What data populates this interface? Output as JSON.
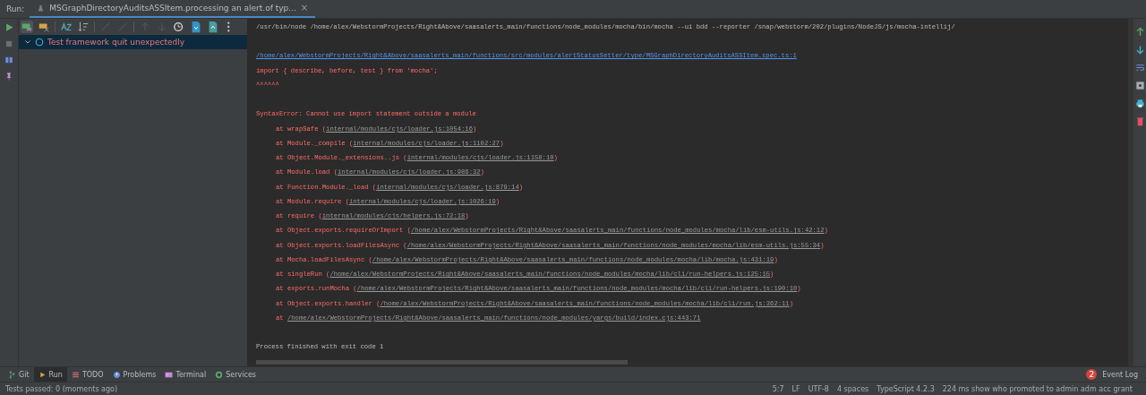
{
  "run_tabs": {
    "label": "Run:",
    "tabs": [
      {
        "title": "MSGraphDirectoryAuditsASSItem.processing an alert.of typ...",
        "close": "×",
        "selected": true
      }
    ]
  },
  "test_tree": {
    "items": [
      {
        "label": "Test framework quit unexpectedly",
        "expanded": true,
        "selected": true
      }
    ]
  },
  "console": {
    "lines": [
      {
        "kind": "plain",
        "parts": [
          {
            "kind": "text",
            "text": "/usr/bin/node /home/alex/WebstormProjects/Right&Above/saasalerts_main/functions/node_modules/mocha/bin/mocha --ui bdd --reporter /snap/webstorm/202/plugins/NodeJS/js/mocha-intellij/"
          }
        ]
      },
      {
        "kind": "blank"
      },
      {
        "kind": "error",
        "parts": [
          {
            "kind": "file_link",
            "text": "/home/alex/WebstormProjects/Right&Above/saasalerts_main/functions/src/modules/alertStatusSetter/type/MSGraphDirectoryAuditsASSItem.spec.ts:1"
          }
        ]
      },
      {
        "kind": "error",
        "parts": [
          {
            "kind": "text",
            "text": "import { describe, before, test } from 'mocha';"
          }
        ]
      },
      {
        "kind": "error",
        "parts": [
          {
            "kind": "text",
            "text": "^^^^^^"
          }
        ]
      },
      {
        "kind": "blank"
      },
      {
        "kind": "error",
        "parts": [
          {
            "kind": "text",
            "text": "SyntaxError: Cannot use import statement outside a module"
          }
        ]
      },
      {
        "kind": "stack",
        "parts": [
          {
            "kind": "text",
            "text": "at wrapSafe ("
          },
          {
            "kind": "link",
            "text": "internal/modules/cjs/loader.js:1054:16"
          },
          {
            "kind": "text",
            "text": ")"
          }
        ]
      },
      {
        "kind": "stack",
        "parts": [
          {
            "kind": "text",
            "text": "at Module._compile ("
          },
          {
            "kind": "link",
            "text": "internal/modules/cjs/loader.js:1102:27"
          },
          {
            "kind": "text",
            "text": ")"
          }
        ]
      },
      {
        "kind": "stack",
        "parts": [
          {
            "kind": "text",
            "text": "at Object.Module._extensions..js ("
          },
          {
            "kind": "link",
            "text": "internal/modules/cjs/loader.js:1158:10"
          },
          {
            "kind": "text",
            "text": ")"
          }
        ]
      },
      {
        "kind": "stack",
        "parts": [
          {
            "kind": "text",
            "text": "at Module.load ("
          },
          {
            "kind": "link",
            "text": "internal/modules/cjs/loader.js:986:32"
          },
          {
            "kind": "text",
            "text": ")"
          }
        ]
      },
      {
        "kind": "stack",
        "parts": [
          {
            "kind": "text",
            "text": "at Function.Module._load ("
          },
          {
            "kind": "link",
            "text": "internal/modules/cjs/loader.js:879:14"
          },
          {
            "kind": "text",
            "text": ")"
          }
        ]
      },
      {
        "kind": "stack",
        "parts": [
          {
            "kind": "text",
            "text": "at Module.require ("
          },
          {
            "kind": "link",
            "text": "internal/modules/cjs/loader.js:1026:19"
          },
          {
            "kind": "text",
            "text": ")"
          }
        ]
      },
      {
        "kind": "stack",
        "parts": [
          {
            "kind": "text",
            "text": "at require ("
          },
          {
            "kind": "link",
            "text": "internal/modules/cjs/helpers.js:72:18"
          },
          {
            "kind": "text",
            "text": ")"
          }
        ]
      },
      {
        "kind": "stack",
        "parts": [
          {
            "kind": "text",
            "text": "at Object.exports.requireOrImport ("
          },
          {
            "kind": "link",
            "text": "/home/alex/WebstormProjects/Right&Above/saasalerts_main/functions/node_modules/mocha/lib/esm-utils.js:42:12"
          },
          {
            "kind": "text",
            "text": ")"
          }
        ]
      },
      {
        "kind": "stack",
        "parts": [
          {
            "kind": "text",
            "text": "at Object.exports.loadFilesAsync ("
          },
          {
            "kind": "link",
            "text": "/home/alex/WebstormProjects/Right&Above/saasalerts_main/functions/node_modules/mocha/lib/esm-utils.js:55:34"
          },
          {
            "kind": "text",
            "text": ")"
          }
        ]
      },
      {
        "kind": "stack",
        "parts": [
          {
            "kind": "text",
            "text": "at Mocha.loadFilesAsync ("
          },
          {
            "kind": "link",
            "text": "/home/alex/WebstormProjects/Right&Above/saasalerts_main/functions/node_modules/mocha/lib/mocha.js:431:19"
          },
          {
            "kind": "text",
            "text": ")"
          }
        ]
      },
      {
        "kind": "stack",
        "parts": [
          {
            "kind": "text",
            "text": "at singleRun ("
          },
          {
            "kind": "link",
            "text": "/home/alex/WebstormProjects/Right&Above/saasalerts_main/functions/node_modules/mocha/lib/cli/run-helpers.js:125:15"
          },
          {
            "kind": "text",
            "text": ")"
          }
        ]
      },
      {
        "kind": "stack",
        "parts": [
          {
            "kind": "text",
            "text": "at exports.runMocha ("
          },
          {
            "kind": "link",
            "text": "/home/alex/WebstormProjects/Right&Above/saasalerts_main/functions/node_modules/mocha/lib/cli/run-helpers.js:190:10"
          },
          {
            "kind": "text",
            "text": ")"
          }
        ]
      },
      {
        "kind": "stack",
        "parts": [
          {
            "kind": "text",
            "text": "at Object.exports.handler ("
          },
          {
            "kind": "link",
            "text": "/home/alex/WebstormProjects/Right&Above/saasalerts_main/functions/node_modules/mocha/lib/cli/run.js:362:11"
          },
          {
            "kind": "text",
            "text": ")"
          }
        ]
      },
      {
        "kind": "stack",
        "parts": [
          {
            "kind": "text",
            "text": "at "
          },
          {
            "kind": "link",
            "text": "/home/alex/WebstormProjects/Right&Above/saasalerts_main/functions/node_modules/yargs/build/index.cjs:443:71"
          }
        ]
      },
      {
        "kind": "blank"
      },
      {
        "kind": "plain",
        "parts": [
          {
            "kind": "text",
            "text": "Process finished with exit code 1"
          }
        ]
      }
    ]
  },
  "tool_windows": {
    "left": [
      {
        "label": "Git",
        "selected": false
      },
      {
        "label": "Run",
        "selected": true
      },
      {
        "label": "TODO",
        "selected": false
      },
      {
        "label": "Problems",
        "selected": false
      },
      {
        "label": "Terminal",
        "selected": false
      },
      {
        "label": "Services",
        "selected": false
      }
    ],
    "event_log": {
      "label": "Event Log",
      "count": "2"
    }
  },
  "status_bar": {
    "message": "Tests passed: 0 (moments ago)",
    "items": [
      "5:7",
      "LF",
      "UTF-8",
      "4 spaces",
      "TypeScript 4.2.3",
      "224 ms show who promoted to admin adm acc grant"
    ]
  }
}
